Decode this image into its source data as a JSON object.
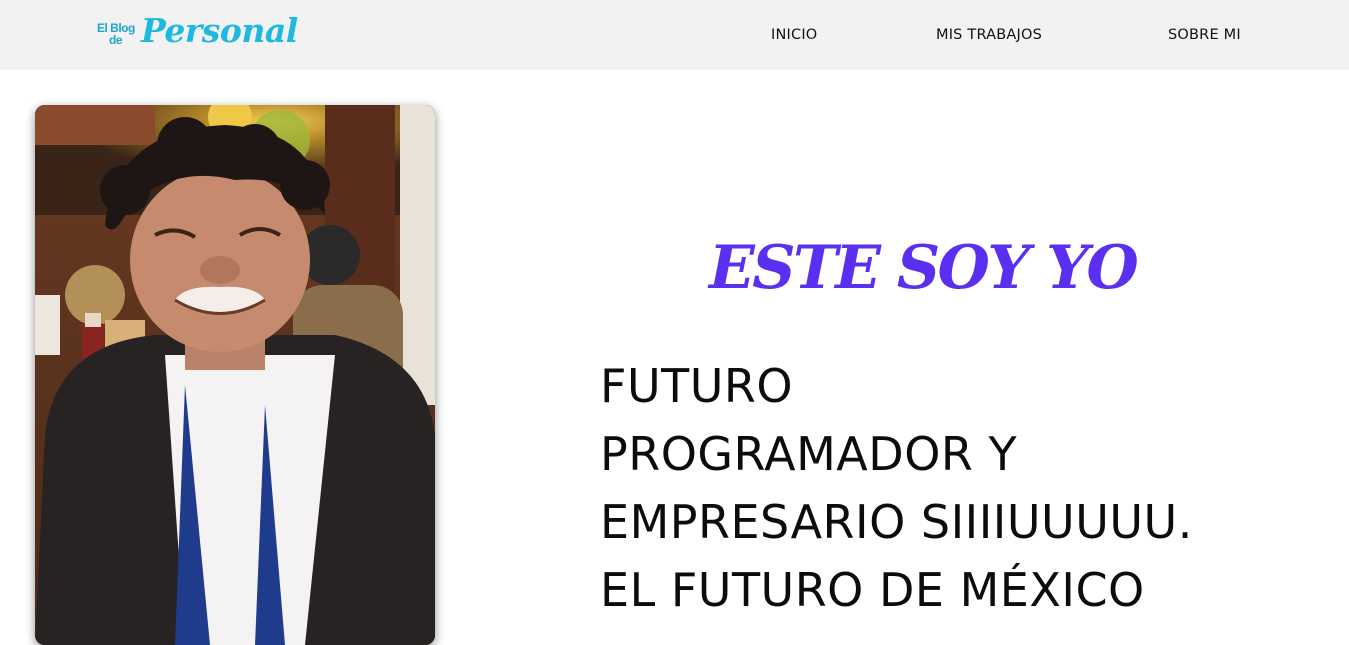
{
  "logo": {
    "small_line1": "El Blog",
    "small_line2": "de",
    "big": "Personal",
    "color": "#1fb8de"
  },
  "nav": {
    "items": [
      {
        "label": "INICIO"
      },
      {
        "label": "MIS TRABAJOS"
      },
      {
        "label": "SOBRE MI"
      }
    ]
  },
  "hero": {
    "title": "ESTE SOY YO",
    "title_color": "#5b2ff0",
    "lines": [
      "FUTURO",
      "PROGRAMADOR Y",
      "EMPRESARIO SIIIIUUUUU.",
      "EL FUTURO DE MÉXICO"
    ]
  },
  "colors": {
    "navbar_bg": "#f2f2f2",
    "page_bg": "#ffffff"
  }
}
